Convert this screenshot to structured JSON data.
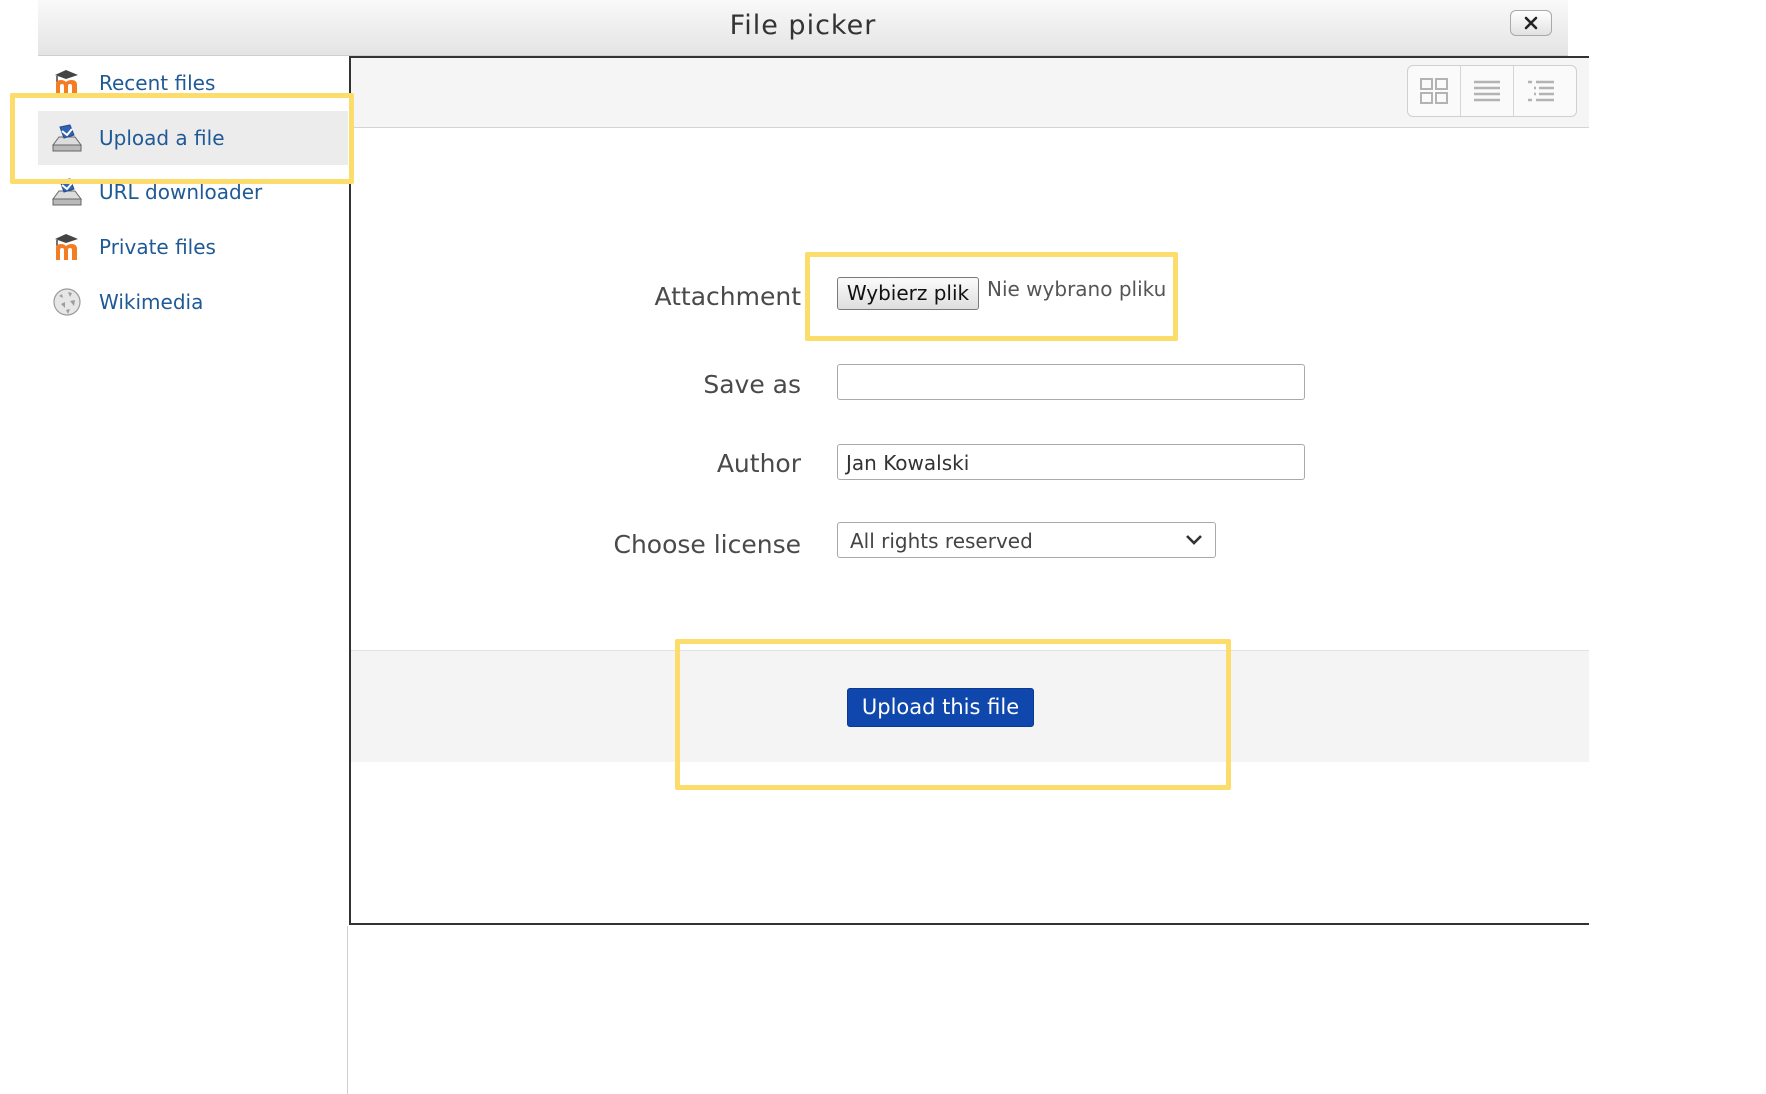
{
  "window": {
    "title": "File picker",
    "close_icon": "close-icon"
  },
  "sidebar": {
    "items": [
      {
        "label": "Recent files",
        "icon": "moodle-icon",
        "active": false
      },
      {
        "label": "Upload a file",
        "icon": "upload-icon",
        "active": true
      },
      {
        "label": "URL downloader",
        "icon": "download-icon",
        "active": false
      },
      {
        "label": "Private files",
        "icon": "moodle-icon",
        "active": false
      },
      {
        "label": "Wikimedia",
        "icon": "wikimedia-icon",
        "active": false
      }
    ]
  },
  "toolbar": {
    "views": [
      "icons-view-icon",
      "details-view-icon",
      "tree-view-icon"
    ]
  },
  "form": {
    "attachment": {
      "label": "Attachment",
      "button": "Wybierz plik",
      "status": "Nie wybrano pliku"
    },
    "save_as": {
      "label": "Save as",
      "value": ""
    },
    "author": {
      "label": "Author",
      "value": "Jan Kowalski"
    },
    "license": {
      "label": "Choose license",
      "selected": "All rights reserved"
    },
    "submit_label": "Upload this file"
  },
  "colors": {
    "link": "#1f5a96",
    "primary_button": "#0f47ad",
    "highlight": "#fcdc6a"
  }
}
